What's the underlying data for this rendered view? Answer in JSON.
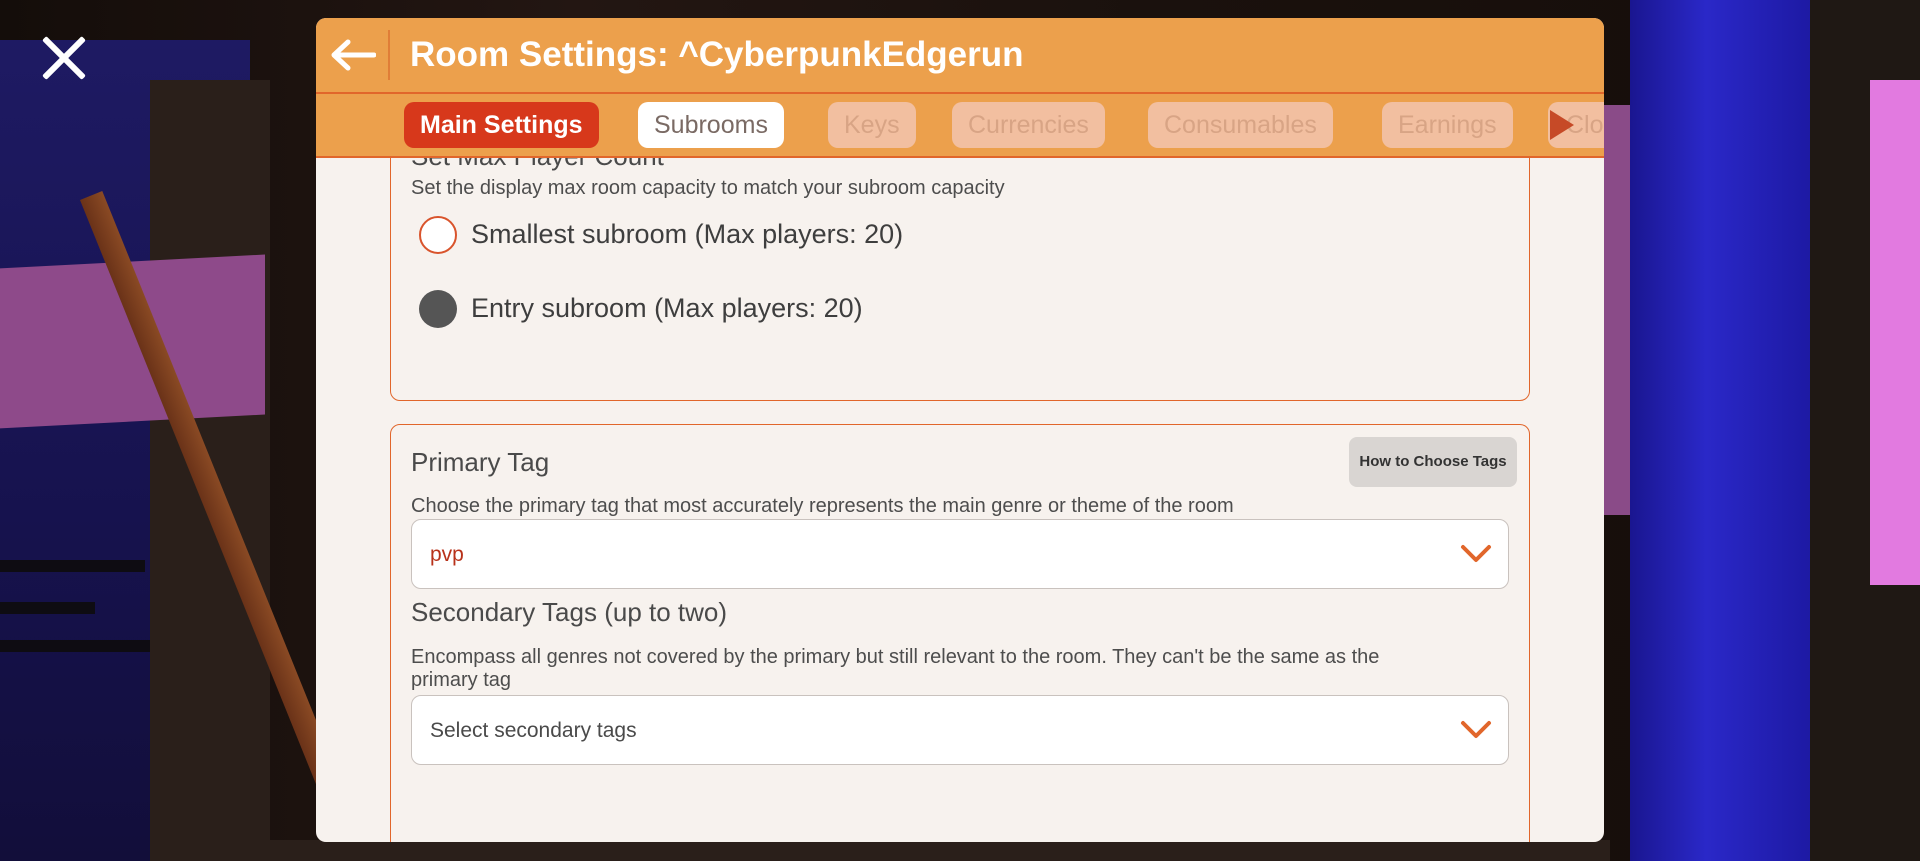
{
  "header": {
    "title": "Room Settings: ^CyberpunkEdgerun"
  },
  "tabs": [
    {
      "label": "Main Settings",
      "state": "active"
    },
    {
      "label": "Subrooms",
      "state": "selected"
    },
    {
      "label": "Keys",
      "state": "inactive"
    },
    {
      "label": "Currencies",
      "state": "inactive"
    },
    {
      "label": "Consumables",
      "state": "inactive"
    },
    {
      "label": "Earnings",
      "state": "inactive"
    }
  ],
  "tab_overflow_text": "Clo",
  "max_player": {
    "title": "Set Max Player Count",
    "description": "Set the display max room capacity to match your subroom capacity",
    "options": [
      {
        "label": "Smallest subroom (Max players: 20)",
        "selected": false
      },
      {
        "label": "Entry subroom (Max players: 20)",
        "selected": true
      }
    ]
  },
  "tags": {
    "primary_title": "Primary Tag",
    "help_button": "How to Choose Tags",
    "primary_description": "Choose the primary tag that most accurately represents the main genre or theme of the room",
    "primary_value": "pvp",
    "secondary_title": "Secondary Tags (up to two)",
    "secondary_description_line1": "Encompass all genres not covered by the primary but still relevant to the room. They can't be the same as the",
    "secondary_description_line2": "primary tag",
    "secondary_placeholder": "Select secondary tags"
  },
  "colors": {
    "header_orange": "#eca04c",
    "accent_red": "#d7381b",
    "border_orange": "#e1662b",
    "panel_bg": "#f7f2ee",
    "primary_value_color": "#b8321a"
  }
}
